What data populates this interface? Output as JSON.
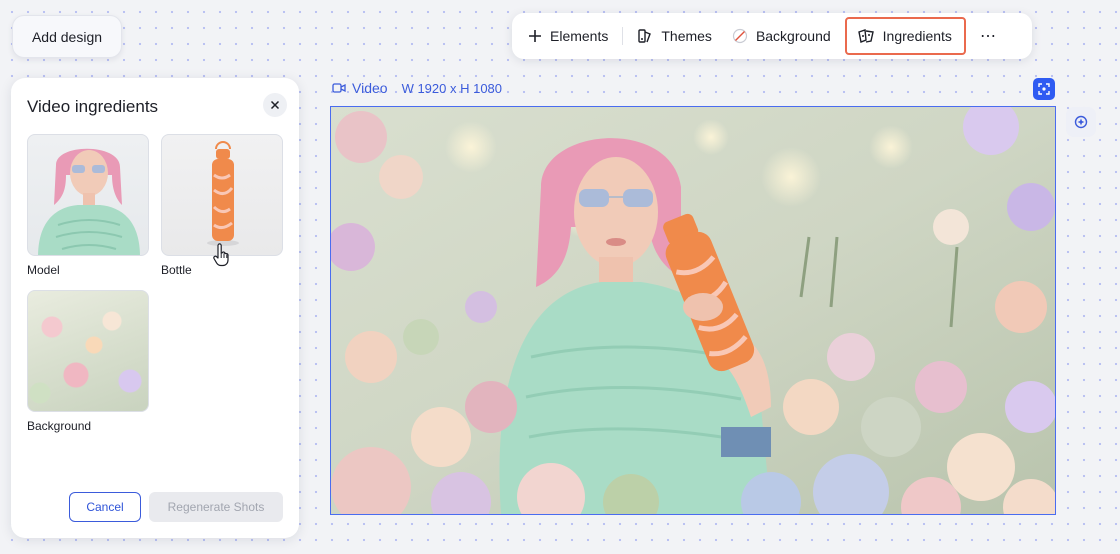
{
  "header": {
    "add_design_label": "Add design"
  },
  "toolbar": {
    "items": [
      {
        "label": "Elements",
        "icon": "plus-icon"
      },
      {
        "label": "Themes",
        "icon": "themes-icon"
      },
      {
        "label": "Background",
        "icon": "background-icon"
      },
      {
        "label": "Ingredients",
        "icon": "ingredients-icon",
        "active": true
      }
    ],
    "more_label": "⋯"
  },
  "panel": {
    "title": "Video ingredients",
    "ingredients": [
      {
        "label": "Model"
      },
      {
        "label": "Bottle"
      },
      {
        "label": "Background"
      }
    ],
    "cancel_label": "Cancel",
    "regenerate_label": "Regenerate Shots"
  },
  "canvas": {
    "video_label": "Video",
    "dimensions": "W 1920 x H 1080"
  },
  "colors": {
    "accent": "#3b5bdb",
    "active_outline": "#ea6a4e",
    "bottle": "#f08a4b",
    "sweater": "#a9dcc6",
    "hair": "#e99ab6"
  }
}
